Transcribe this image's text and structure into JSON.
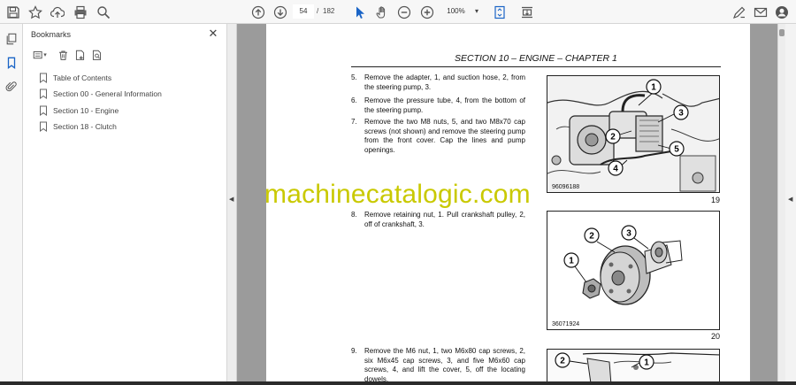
{
  "toolbar": {
    "page_current": "54",
    "page_separator": "/",
    "page_total": "182",
    "zoom": "100%"
  },
  "bookmarks_panel": {
    "title": "Bookmarks",
    "close_label": "✕",
    "items": [
      {
        "label": "Table of Contents"
      },
      {
        "label": "Section 00 - General Information"
      },
      {
        "label": "Section 10 - Engine"
      },
      {
        "label": "Section 18 - Clutch"
      }
    ]
  },
  "document": {
    "header": "SECTION 10 – ENGINE – CHAPTER 1",
    "steps": [
      {
        "num": "5.",
        "text": "Remove the adapter, 1, and suction hose, 2, from the steering pump, 3."
      },
      {
        "num": "6.",
        "text": "Remove the pressure tube, 4, from the bottom of the steering pump."
      },
      {
        "num": "7.",
        "text": "Remove the two M8 nuts, 5, and two M8x70 cap screws (not shown) and remove the steering pump from the front cover. Cap the lines and pump openings."
      },
      {
        "num": "8.",
        "text": "Remove retaining nut, 1. Pull crankshaft pulley, 2, off of crankshaft, 3."
      },
      {
        "num": "9.",
        "text": "Remove the M6 nut, 1, two M6x80 cap screws, 2, six M6x45 cap screws, 3, and five M6x60 cap screws, 4, and lift the cover, 5, off the locating dowels."
      }
    ],
    "figures": [
      {
        "code": "96096188",
        "number": "19",
        "callouts": [
          "1",
          "2",
          "3",
          "4",
          "5"
        ]
      },
      {
        "code": "36071924",
        "number": "20",
        "callouts": [
          "1",
          "2",
          "3"
        ]
      },
      {
        "callouts": [
          "2",
          "1"
        ]
      }
    ]
  },
  "watermark": "machinecatalogic.com"
}
